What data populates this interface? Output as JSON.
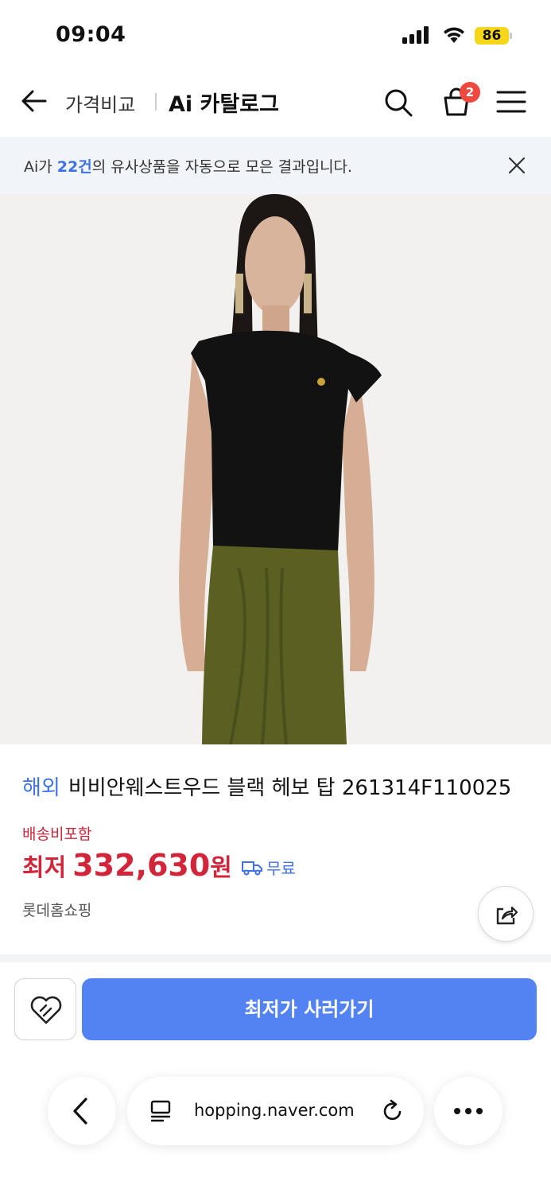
{
  "status_bar": {
    "time": "09:04",
    "battery": "86"
  },
  "header": {
    "compare_label": "가격비교",
    "title": "Ai 카탈로그",
    "cart_count": "2"
  },
  "banner": {
    "prefix": "Ai가 ",
    "count": "22건",
    "suffix": "의 유사상품을 자동으로 모은 결과입니다."
  },
  "product": {
    "origin": "해외",
    "name": "비비안웨스트우드 블랙 헤보 탑 261314F110025",
    "shipping_note": "배송비포함",
    "price_label": "최저",
    "price": "332,630",
    "price_unit": "원",
    "free_shipping": "무료",
    "seller": "롯데홈쇼핑"
  },
  "actions": {
    "buy_label": "최저가 사러가기"
  },
  "browser": {
    "url": "hopping.naver.com"
  },
  "colors": {
    "accent": "#5383f2",
    "price": "#d2253a",
    "link": "#3f72e8",
    "badge": "#f0473e"
  },
  "icons": [
    "back-arrow-icon",
    "search-icon",
    "cart-icon",
    "menu-icon",
    "close-icon",
    "truck-icon",
    "share-icon",
    "wish-heart-icon",
    "chevron-left-icon",
    "reader-icon",
    "reload-icon",
    "more-icon"
  ]
}
